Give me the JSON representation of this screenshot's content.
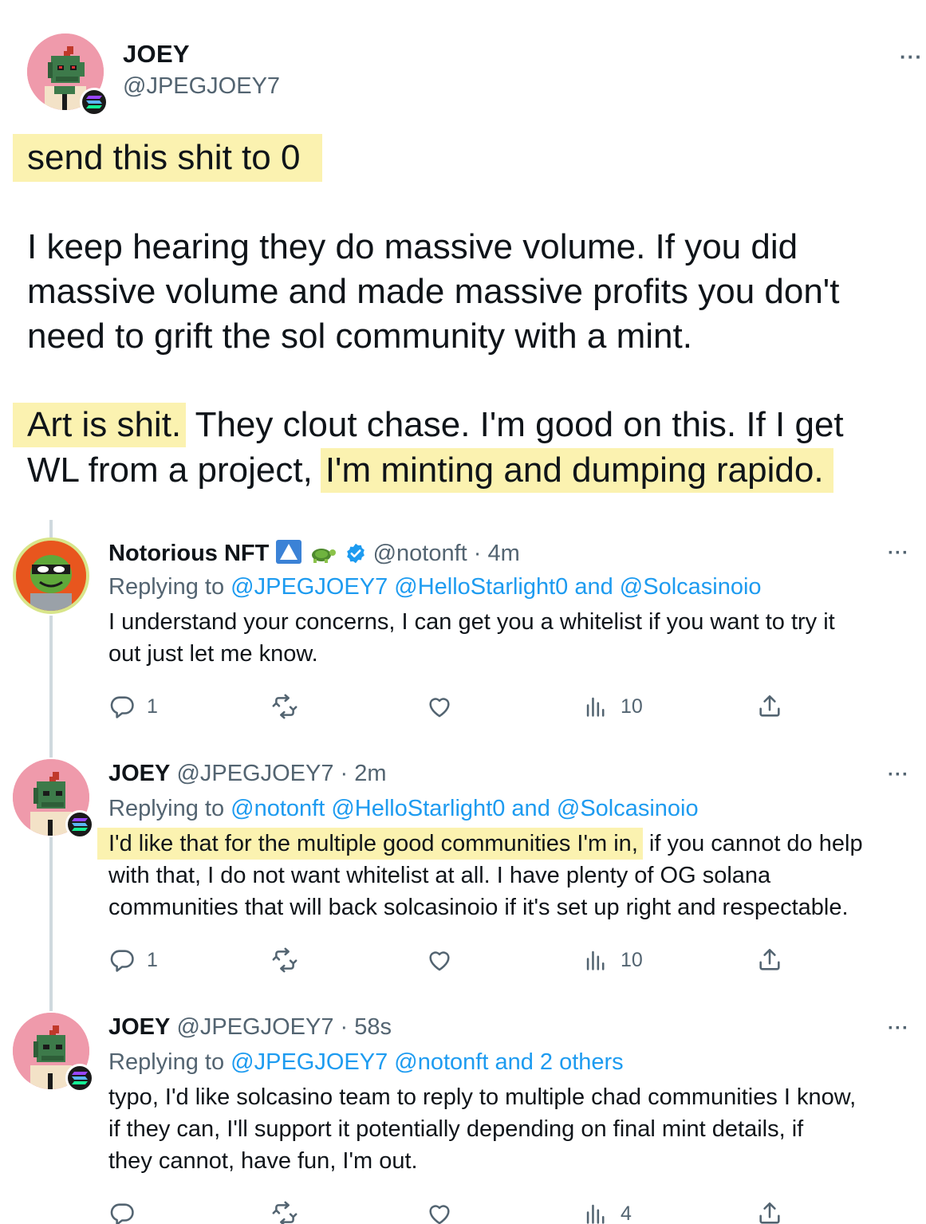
{
  "main": {
    "name": "JOEY",
    "handle": "@JPEGJOEY7",
    "more": "···",
    "lines": {
      "l1": "send this shit to 0",
      "l2": "I keep hearing they do massive volume. If you did",
      "l3": "massive volume and made massive profits you don't",
      "l4": "need to grift the sol community with a mint.",
      "l5a": "Art is shit.",
      "l5b": " They clout chase. I'm good on this. If I get",
      "l6a": "WL from a project,",
      "l6b": "I'm minting and dumping rapido."
    }
  },
  "replies": [
    {
      "name": "Notorious NFT",
      "handle": "@notonft",
      "time": "4m",
      "replying_prefix": "Replying to",
      "replying_links": "@JPEGJOEY7 @HelloStarlight0 and @Solcasinoio",
      "text": [
        "I understand your concerns, I can get you a whitelist if you want to try it",
        "out just let me know."
      ],
      "counts": {
        "reply": "1",
        "views": "10"
      }
    },
    {
      "name": "JOEY",
      "handle": "@JPEGJOEY7",
      "time": "2m",
      "replying_prefix": "Replying to",
      "replying_links": "@notonft @HelloStarlight0 and @Solcasinoio",
      "text_highlight": "I'd like that for the multiple good communities I'm in,",
      "text_rest": " if you cannot do help",
      "text": [
        "with that, I do not want whitelist at all. I have plenty of OG solana",
        "communities that will back solcasinoio if it's set up right and respectable."
      ],
      "counts": {
        "reply": "1",
        "views": "10"
      }
    },
    {
      "name": "JOEY",
      "handle": "@JPEGJOEY7",
      "time": "58s",
      "replying_prefix": "Replying to",
      "replying_links": "@JPEGJOEY7 @notonft and 2 others",
      "text": [
        "typo, I'd like solcasino team to reply to multiple chad communities I know,",
        "if they can, I'll support it potentially depending on final mint details, if",
        "they cannot, have fun, I'm out."
      ],
      "counts": {
        "reply": "",
        "views": "4"
      }
    }
  ],
  "separator": " · ",
  "more": "···",
  "icons": {
    "reply": "reply-icon",
    "retweet": "retweet-icon",
    "like": "heart-icon",
    "views": "views-icon",
    "share": "share-icon"
  },
  "colors": {
    "link": "#1d9bf0",
    "muted": "#536471",
    "highlight": "#fbf2b0",
    "avatar_bg": "#ef9aab"
  }
}
